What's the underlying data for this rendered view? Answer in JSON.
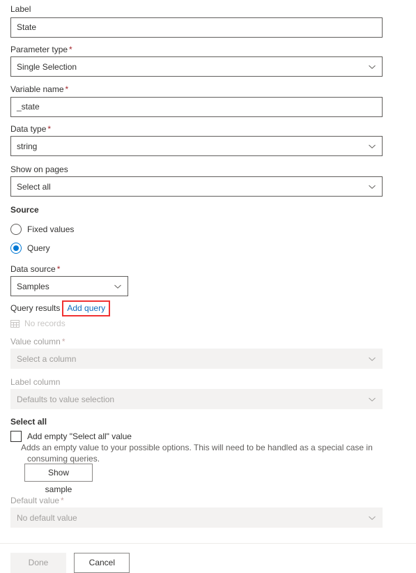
{
  "form": {
    "fields": {
      "label": {
        "label": "Label",
        "value": "State",
        "required": false
      },
      "parameter_type": {
        "label": "Parameter type",
        "value": "Single Selection",
        "required": true,
        "icon": "chevron-down-icon"
      },
      "variable_name": {
        "label": "Variable name",
        "value": "_state",
        "required": true
      },
      "data_type": {
        "label": "Data type",
        "value": "string",
        "required": true,
        "icon": "chevron-down-icon"
      },
      "show_on_pages": {
        "label": "Show on pages",
        "value": "Select all",
        "required": false,
        "icon": "chevron-down-icon"
      },
      "data_source": {
        "label": "Data source",
        "value": "Samples",
        "required": true,
        "icon": "chevron-down-icon"
      },
      "value_column": {
        "label": "Value column",
        "value": "Select a column",
        "required": true,
        "disabled": true,
        "icon": "chevron-down-icon"
      },
      "label_column": {
        "label": "Label column",
        "value": "Defaults to value selection",
        "required": false,
        "disabled": true,
        "icon": "chevron-down-icon"
      },
      "default_value": {
        "label": "Default value",
        "value": "No default value",
        "required": true,
        "disabled": true,
        "icon": "chevron-down-icon"
      }
    },
    "source": {
      "title": "Source",
      "options": [
        {
          "label": "Fixed values",
          "selected": false
        },
        {
          "label": "Query",
          "selected": true
        }
      ]
    },
    "query_results": {
      "label": "Query results",
      "link_label": "Add query",
      "empty_icon": "grid-icon",
      "empty_text": "No records",
      "annotated": true
    },
    "select_all": {
      "title": "Select all",
      "checkbox_label": "Add empty \"Select all\" value",
      "checked": false,
      "description": "Adds an empty value to your possible options. This will need to be handled as a special case in consuming queries.",
      "sample_button": "Show sample"
    }
  },
  "footer": {
    "done_label": "Done",
    "done_disabled": true,
    "cancel_label": "Cancel"
  },
  "colors": {
    "accent": "#0078d4",
    "link": "#0f6cbd",
    "required": "#a4262c",
    "annotation": "#f03232",
    "disabled_bg": "#f3f2f1",
    "disabled_text": "#a19f9d",
    "border": "#605e5c"
  }
}
